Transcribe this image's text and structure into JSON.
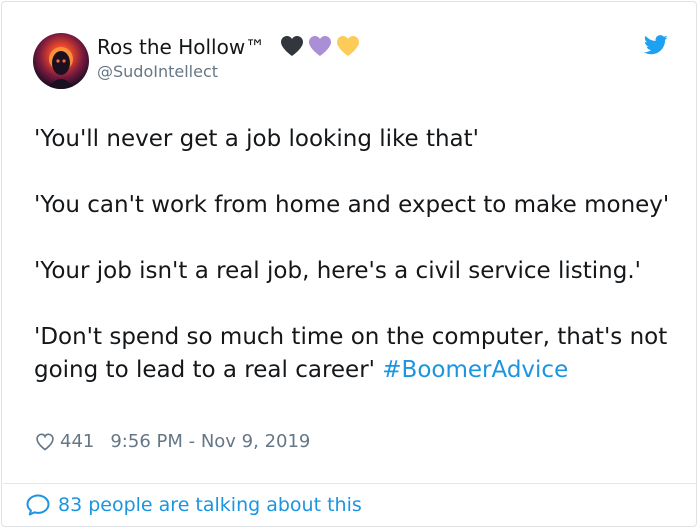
{
  "author": {
    "display_name": "Ros the Hollow™",
    "handle": "@SudoIntellect",
    "name_emoji": [
      "black-heart-icon",
      "purple-heart-icon",
      "yellow-heart-icon"
    ]
  },
  "tweet": {
    "paragraphs": [
      "'You'll never get a job looking like that'",
      "'You can't work from home and expect to make money'",
      "'Your job isn't a real job, here's a civil service listing.'",
      "'Don't spend so much time on the computer, that's not going to lead to a real career'"
    ],
    "hashtag": "#BoomerAdvice"
  },
  "meta": {
    "like_count": "441",
    "timestamp": "9:56 PM - Nov 9, 2019"
  },
  "footer": {
    "talking_label": "83 people are talking about this"
  },
  "colors": {
    "accent": "#1b95e0",
    "text": "#14171a",
    "muted": "#657786",
    "black_heart": "#31373d",
    "purple_heart": "#aa8ed6",
    "yellow_heart": "#fdcb58"
  }
}
